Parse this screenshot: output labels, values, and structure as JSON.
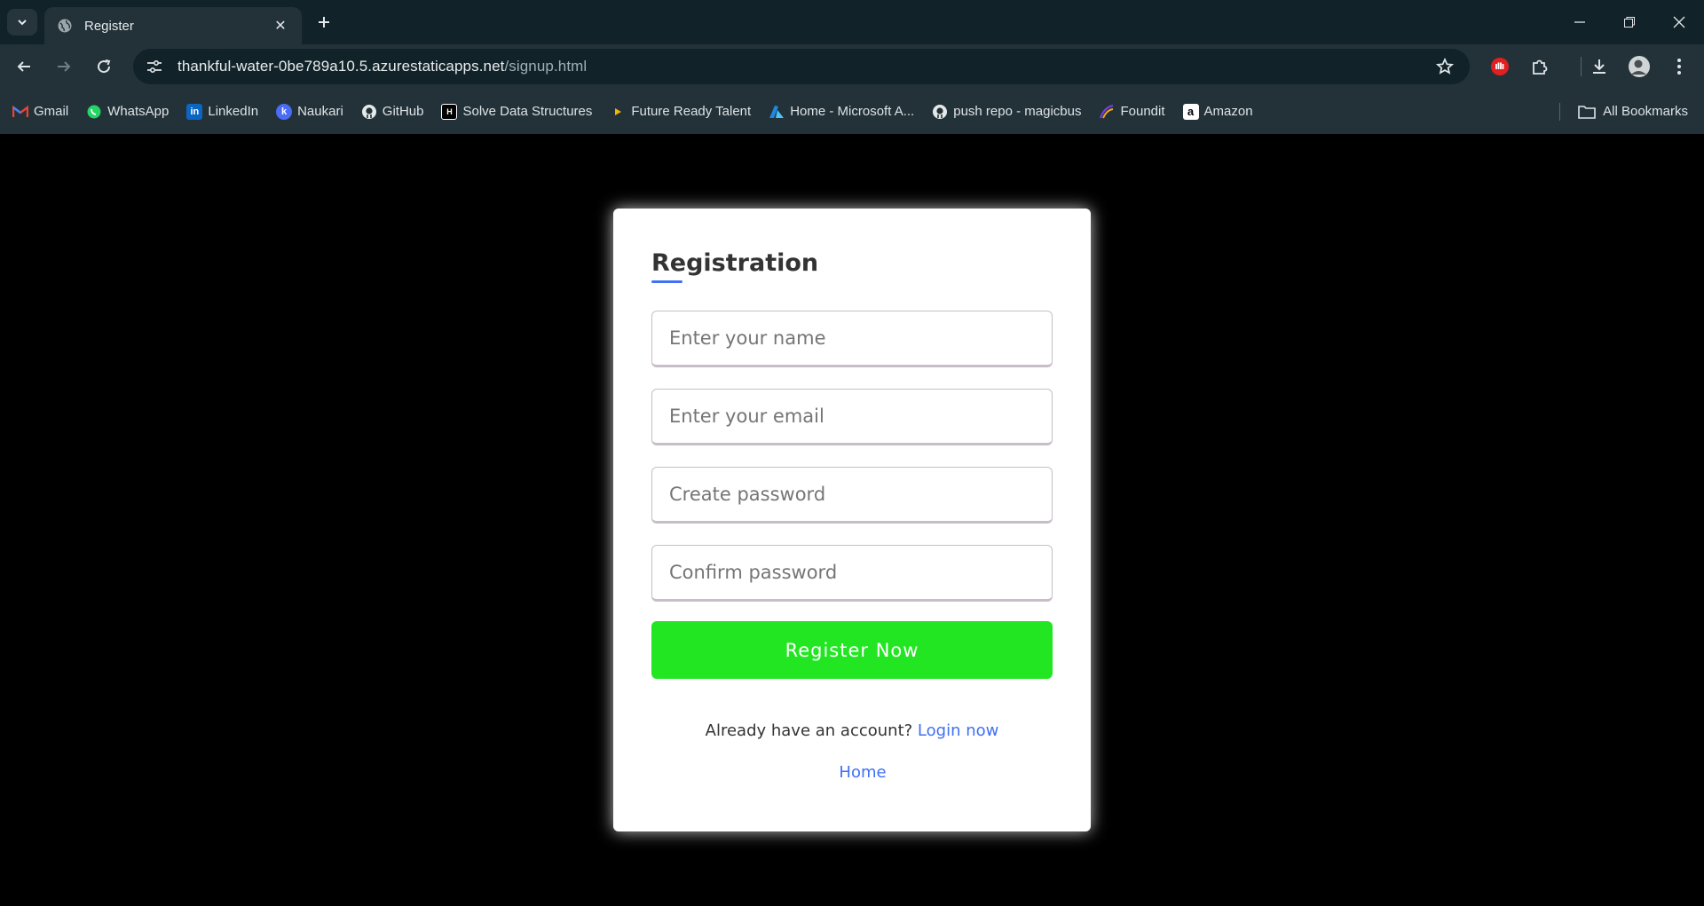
{
  "browser": {
    "tab_title": "Register",
    "url_host": "thankful-water-0be789a10.5.azurestaticapps.net",
    "url_path": "/signup.html",
    "bookmarks": [
      {
        "label": "Gmail",
        "icon": "gmail-icon"
      },
      {
        "label": "WhatsApp",
        "icon": "whatsapp-icon"
      },
      {
        "label": "LinkedIn",
        "icon": "linkedin-icon"
      },
      {
        "label": "Naukari",
        "icon": "naukri-icon"
      },
      {
        "label": "GitHub",
        "icon": "github-icon"
      },
      {
        "label": "Solve Data Structures",
        "icon": "hackerrank-icon"
      },
      {
        "label": "Future Ready Talent",
        "icon": "play-icon"
      },
      {
        "label": "Home - Microsoft A...",
        "icon": "azure-icon"
      },
      {
        "label": "push repo - magicbus",
        "icon": "github-icon"
      },
      {
        "label": "Foundit",
        "icon": "foundit-icon"
      },
      {
        "label": "Amazon",
        "icon": "amazon-icon"
      }
    ],
    "all_bookmarks_label": "All Bookmarks"
  },
  "form": {
    "title": "Registration",
    "name_placeholder": "Enter your name",
    "email_placeholder": "Enter your email",
    "password_placeholder": "Create password",
    "confirm_placeholder": "Confirm password",
    "submit_label": "Register Now",
    "account_prompt": "Already have an account?",
    "login_link": "Login now",
    "home_link": "Home"
  },
  "colors": {
    "accent": "#4070f4",
    "button": "#22e622",
    "chrome_bg": "#112228",
    "toolbar_bg": "#233238"
  }
}
